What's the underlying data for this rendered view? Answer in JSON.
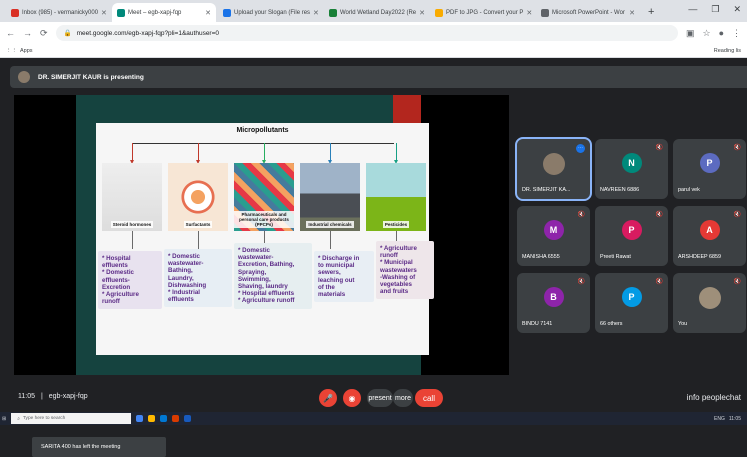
{
  "browser": {
    "tabs": [
      {
        "label": "Inbox (985) - vermanicky000",
        "color": "#d93025",
        "active": false
      },
      {
        "label": "Meet – egb-xapj-fqp",
        "color": "#00897b",
        "active": true
      },
      {
        "label": "Upload your Slogan (File res",
        "color": "#1a73e8",
        "active": false
      },
      {
        "label": "World Wetland Day2022 (Re",
        "color": "#188038",
        "active": false
      },
      {
        "label": "PDF to JPG - Convert your P",
        "color": "#f9ab00",
        "active": false
      },
      {
        "label": "Microsoft PowerPoint - Wor",
        "color": "#5f6368",
        "active": false
      }
    ],
    "new_tab": "+",
    "url": "meet.google.com/egb-xapj-fqp?pli=1&authuser=0",
    "apps_label": "Apps",
    "reading_list": "Reading lis"
  },
  "presenter_banner": "DR. SIMERJIT KAUR is presenting",
  "slide": {
    "title": "Micropollutants",
    "categories": [
      {
        "label": "Steroid hormones",
        "color": "#c0392b"
      },
      {
        "label": "Surfactants",
        "color": "#c0392b"
      },
      {
        "label": "Pharmaceuticals and personal care products (PPCPs)",
        "color": "#27ae60"
      },
      {
        "label": "Industrial chemicals",
        "color": "#2980b9"
      },
      {
        "label": "Pesticides",
        "color": "#16a085"
      }
    ],
    "sources": [
      {
        "lines": [
          "* Hospital",
          "effluents",
          "* Domestic",
          "effluents-",
          "Excretion",
          "* Agriculture",
          "runoff"
        ]
      },
      {
        "lines": [
          "* Domestic",
          "wastewater-",
          "Bathing,",
          "Laundry,",
          "Dishwashing",
          "* Industrial",
          "effluents"
        ]
      },
      {
        "lines": [
          "* Domestic",
          "wastewater-",
          "Excretion, Bathing,",
          "Spraying,",
          "Swimming,",
          "Shaving, laundry",
          "* Hospital effluents",
          "* Agriculture runoff"
        ]
      },
      {
        "lines": [
          "* Discharge in",
          "to municipal",
          "sewers,",
          "leaching out",
          "of the",
          "materials"
        ]
      },
      {
        "lines": [
          "* Agriculture",
          "runoff",
          "* Municipal",
          "wastewaters",
          "-Washing of",
          "vegetables",
          "and fruits"
        ]
      }
    ]
  },
  "toast": "SARITA 400 has left the meeting",
  "participants": [
    {
      "name": "DR. SIMERJIT KA...",
      "initial": "",
      "color": "#8a7b6a",
      "speaking": true
    },
    {
      "name": "NAVREEN 6886",
      "initial": "N",
      "color": "#00897b"
    },
    {
      "name": "parul vek",
      "initial": "P",
      "color": "#5c6bc0"
    },
    {
      "name": "MANISHA 6555",
      "initial": "M",
      "color": "#8e24aa"
    },
    {
      "name": "Preeti Rawat",
      "initial": "P",
      "color": "#d81b60"
    },
    {
      "name": "ARSHDEEP 6859",
      "initial": "A",
      "color": "#e53935"
    },
    {
      "name": "BINDU 7141",
      "initial": "B",
      "color": "#8e24aa"
    },
    {
      "name": "66 others",
      "initial": "P",
      "color": "#039be5"
    },
    {
      "name": "You",
      "initial": "",
      "color": "#9e8f7a"
    }
  ],
  "bottom": {
    "time": "11:05",
    "separator": "|",
    "meeting_code": "egb-xapj-fqp",
    "present_label": "present",
    "more_label": "more",
    "call_label": "call",
    "right_controls": "info peoplechat"
  },
  "taskbar": {
    "search_placeholder": "Type here to search",
    "lang": "ENG",
    "time": "11:05"
  }
}
